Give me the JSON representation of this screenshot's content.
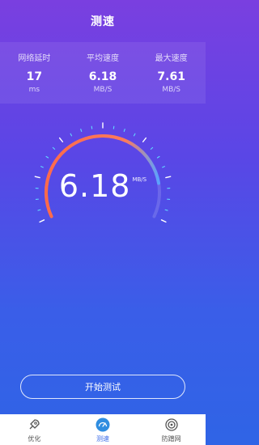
{
  "header": {
    "title": "测速"
  },
  "stats": [
    {
      "label": "网络延时",
      "value": "17",
      "unit": "ms"
    },
    {
      "label": "平均速度",
      "value": "6.18",
      "unit": "MB/S"
    },
    {
      "label": "最大速度",
      "value": "7.61",
      "unit": "MB/S"
    }
  ],
  "gauge": {
    "speed": "6.18",
    "unit": "MB/S",
    "progress": 0.85,
    "colors": {
      "arc_start": "#ff6a4a",
      "arc_end": "#5aa2ff",
      "ticks": "#62d9ff"
    }
  },
  "actions": {
    "start_label": "开始测试"
  },
  "tabbar": {
    "items": [
      {
        "label": "优化",
        "icon": "rocket-icon",
        "active": false
      },
      {
        "label": "测速",
        "icon": "speedometer-icon",
        "active": true
      },
      {
        "label": "防蹭网",
        "icon": "target-icon",
        "active": false
      }
    ]
  }
}
